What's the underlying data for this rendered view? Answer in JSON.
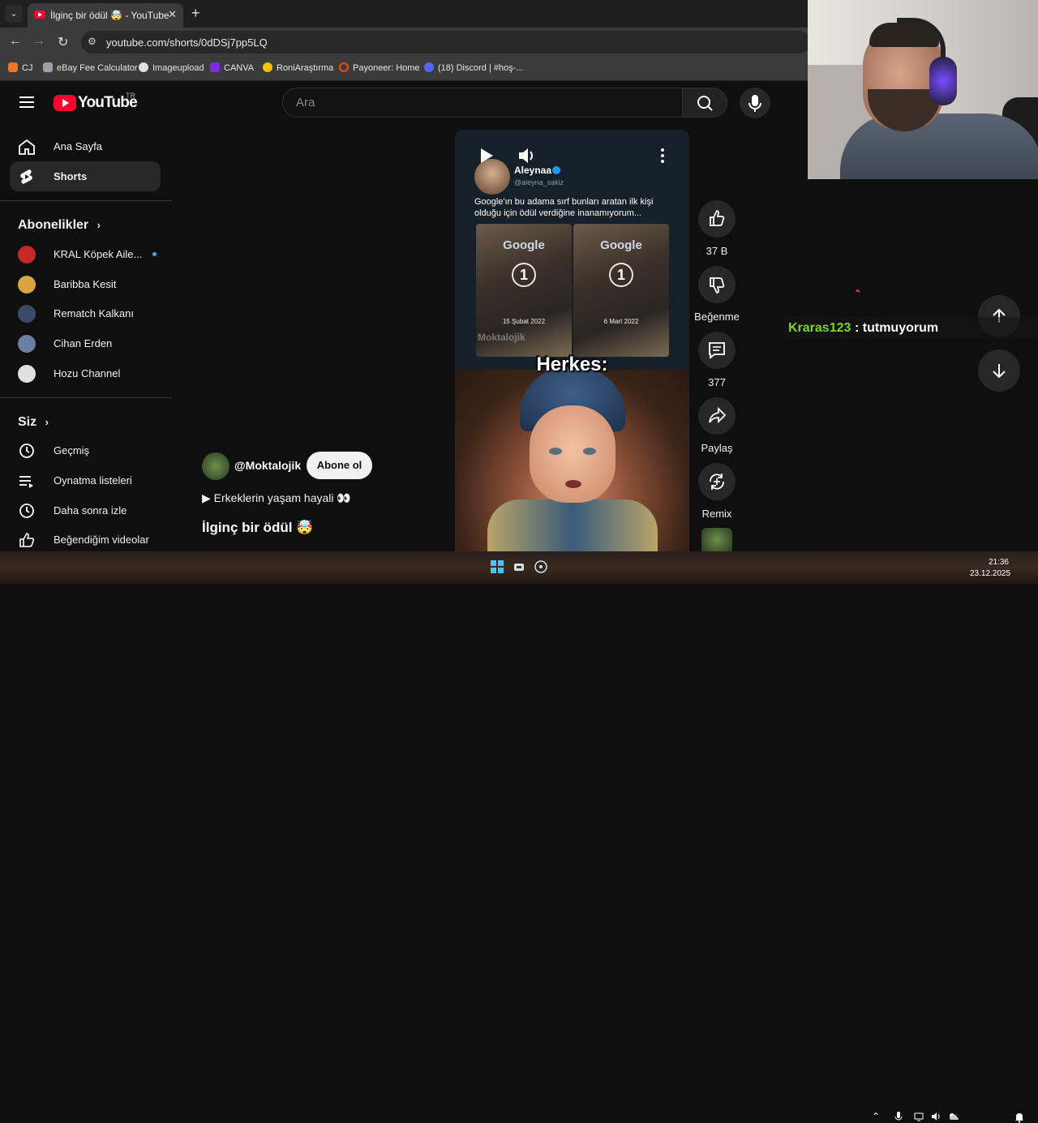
{
  "browser": {
    "tab_title": "İlginç bir ödül 🤯 - YouTube",
    "tab_close": "✕",
    "new_tab": "+",
    "url": "youtube.com/shorts/0dDSj7pp5LQ",
    "bookmarks": [
      {
        "label": "CJ",
        "color": "#e8772e"
      },
      {
        "label": "eBay Fee Calculator",
        "color": "#9aa0a6"
      },
      {
        "label": "Imageupload",
        "color": "#e0e0e0"
      },
      {
        "label": "CANVA",
        "color": "#7d2ae8"
      },
      {
        "label": "RoniAraştırma",
        "color": "#f4c20d"
      },
      {
        "label": "Payoneer: Home",
        "color": "#ff4800"
      },
      {
        "label": "(18) Discord | #hoş-...",
        "color": "#5865f2"
      }
    ]
  },
  "youtube": {
    "logo_text": "YouTube",
    "region": "TR",
    "search_placeholder": "Ara",
    "sidebar": {
      "primary": [
        {
          "label": "Ana Sayfa",
          "icon": "home-icon"
        },
        {
          "label": "Shorts",
          "icon": "shorts-icon",
          "active": true
        }
      ],
      "subscriptions_title": "Abonelikler",
      "subscriptions": [
        {
          "label": "KRAL Köpek Aile...",
          "color": "#c62828",
          "live": true
        },
        {
          "label": "Baribba Kesit",
          "color": "#d9a441"
        },
        {
          "label": "Rematch Kalkanı",
          "color": "#3a4a6a"
        },
        {
          "label": "Cihan Erden",
          "color": "#6b7fa3"
        },
        {
          "label": "Hozu Channel",
          "color": "#e0e0e0"
        }
      ],
      "you_title": "Siz",
      "you_items": [
        {
          "label": "Geçmiş",
          "icon": "history-icon"
        },
        {
          "label": "Oynatma listeleri",
          "icon": "playlist-icon"
        },
        {
          "label": "Daha sonra izle",
          "icon": "clock-icon"
        },
        {
          "label": "Beğendiğim videolar",
          "icon": "thumbs-up-icon"
        }
      ]
    },
    "short": {
      "tweet_name": "Aleynaa",
      "tweet_handle": "@aleyna_sakiz",
      "tweet_text": "Google'ın bu adama sırf bunları aratan ilk kişi olduğu için ödül verdiğine inanamıyorum...",
      "plaque_logo": "Google",
      "plaque_rank": "1",
      "plaque_dates": [
        "15 Şubat 2022",
        "6 Mart 2022"
      ],
      "watermark": "Moktalojik",
      "caption": "Herkes:",
      "channel": "@Moktalojik",
      "subscribe_label": "Abone ol",
      "playlist": "▶ Erkeklerin yaşam hayali 👀",
      "title": "İlginç bir ödül 🤯"
    },
    "actions": {
      "like_count": "37 B",
      "dislike_label": "Beğenme",
      "comment_count": "377",
      "share_label": "Paylaş",
      "remix_label": "Remix"
    }
  },
  "stream": {
    "chat_user": "Kraras123",
    "chat_message": ": tutmuyorum"
  },
  "taskbar": {
    "time": "21:36",
    "date": "23.12.2025"
  }
}
